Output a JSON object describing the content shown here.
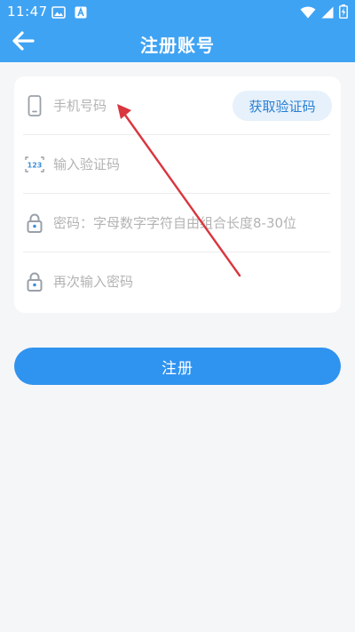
{
  "status_bar": {
    "time": "11:47",
    "icons": [
      "image-icon",
      "a-badge-icon",
      "wifi-icon",
      "signal-icon",
      "battery-charging-icon"
    ]
  },
  "header": {
    "title": "注册账号",
    "back_icon": "arrow-left-icon",
    "color": "#3fa3f3"
  },
  "form": {
    "phone": {
      "placeholder": "手机号码",
      "value": "",
      "icon": "phone-icon"
    },
    "get_code_button": "获取验证码",
    "verify_code": {
      "placeholder": "输入验证码",
      "value": "",
      "icon": "code-123-icon"
    },
    "password": {
      "placeholder": "密码：字母数字字符自由组合长度8-30位",
      "value": "",
      "icon": "lock-icon"
    },
    "confirm_password": {
      "placeholder": "再次输入密码",
      "value": "",
      "icon": "lock-icon"
    }
  },
  "register_button": {
    "label": "注册",
    "color": "#2f93f0"
  },
  "annotation": {
    "color": "#d9363e"
  }
}
